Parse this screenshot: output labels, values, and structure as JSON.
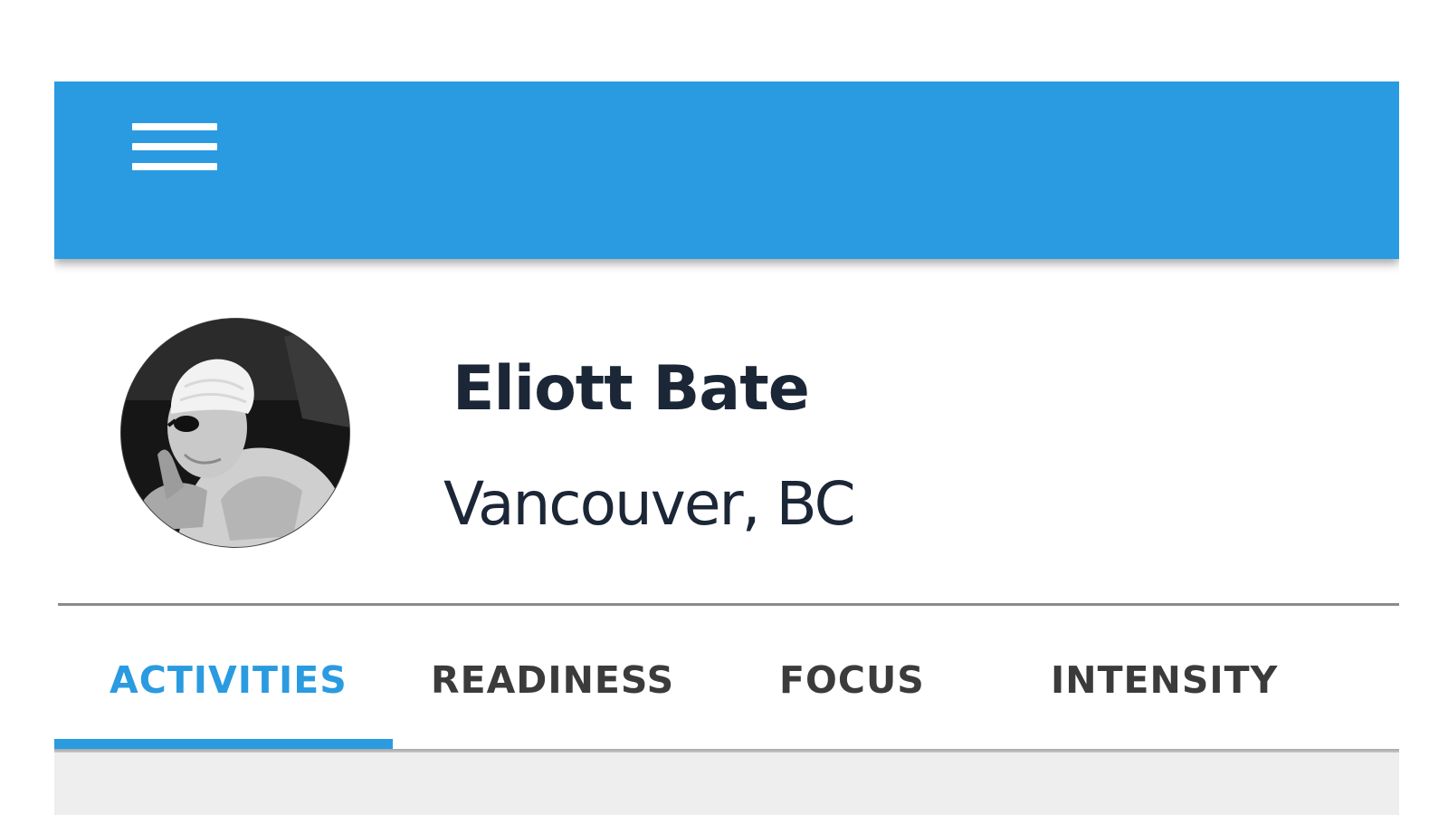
{
  "app_bar": {
    "background_color": "#2a9be0",
    "menu_icon": "hamburger-menu-icon"
  },
  "profile": {
    "avatar_icon": "profile-photo-swimmer",
    "name": "Eliott Bate",
    "location": "Vancouver, BC"
  },
  "tabs": [
    {
      "label": "ACTIVITIES",
      "active": true
    },
    {
      "label": "READINESS",
      "active": false
    },
    {
      "label": "FOCUS",
      "active": false
    },
    {
      "label": "INTENSITY",
      "active": false
    }
  ],
  "colors": {
    "accent": "#2a9be0",
    "text_dark": "#1b2636",
    "tab_inactive": "#3b3b3b"
  }
}
